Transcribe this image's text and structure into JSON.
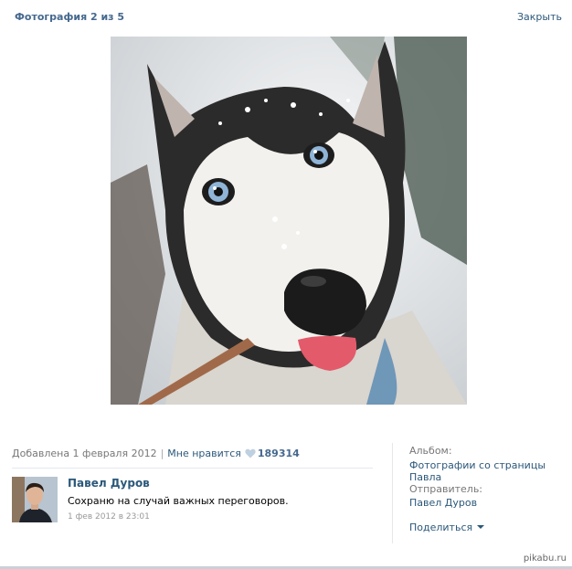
{
  "header": {
    "title": "Фотография 2 из 5",
    "close_label": "Закрыть"
  },
  "photo": {
    "subject": "husky-dog-photo"
  },
  "info": {
    "added": "Добавлена 1 февраля 2012",
    "like_label": "Мне нравится",
    "like_count": "189314"
  },
  "comment": {
    "author": "Павел Дуров",
    "text": "Сохраню на случай важных переговоров.",
    "date": "1 фев 2012 в 23:01"
  },
  "sidebar": {
    "album_label": "Альбом:",
    "album_name": "Фотографии со страницы Павла",
    "sender_label": "Отправитель:",
    "sender_name": "Павел Дуров",
    "share_label": "Поделиться"
  },
  "watermark": "pikabu.ru",
  "colors": {
    "link": "#2b587a",
    "title": "#45688e",
    "muted": "#777777"
  }
}
